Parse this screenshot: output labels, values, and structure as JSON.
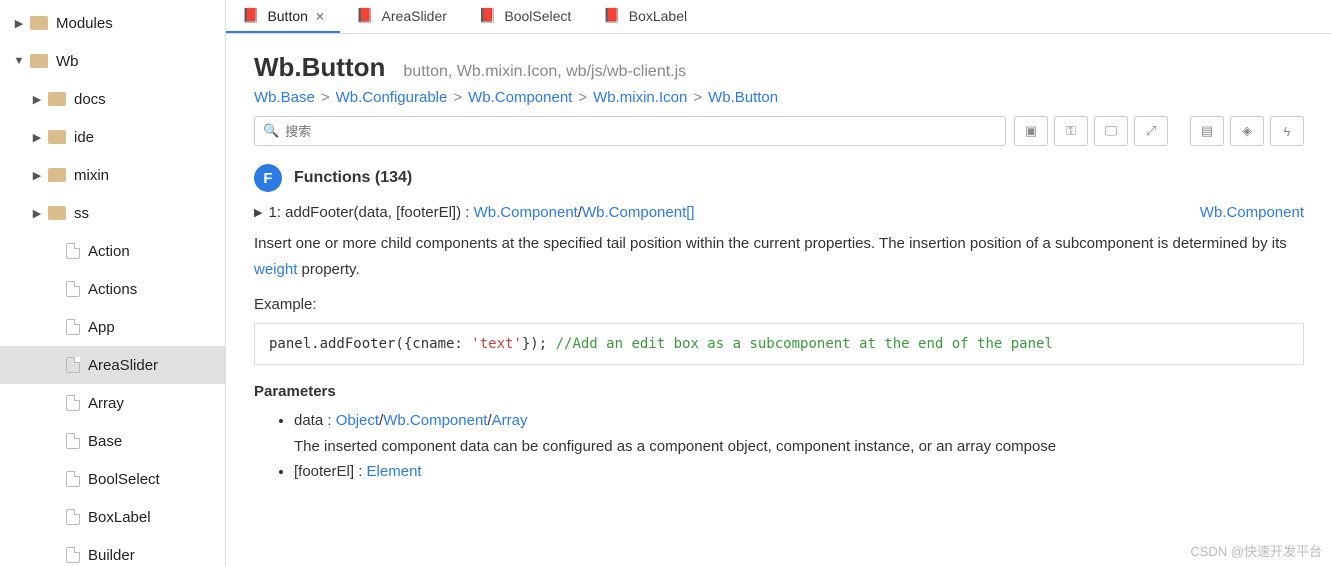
{
  "sidebar": {
    "items": [
      {
        "label": "Modules",
        "type": "folder",
        "arrow": "right",
        "depth": 0
      },
      {
        "label": "Wb",
        "type": "folder",
        "arrow": "down",
        "depth": 0
      },
      {
        "label": "docs",
        "type": "folder",
        "arrow": "right",
        "depth": 1
      },
      {
        "label": "ide",
        "type": "folder",
        "arrow": "right",
        "depth": 1
      },
      {
        "label": "mixin",
        "type": "folder",
        "arrow": "right",
        "depth": 1
      },
      {
        "label": "ss",
        "type": "folder",
        "arrow": "right",
        "depth": 1
      },
      {
        "label": "Action",
        "type": "file",
        "depth": 2
      },
      {
        "label": "Actions",
        "type": "file",
        "depth": 2
      },
      {
        "label": "App",
        "type": "file",
        "depth": 2
      },
      {
        "label": "AreaSlider",
        "type": "file",
        "depth": 2,
        "selected": true
      },
      {
        "label": "Array",
        "type": "file",
        "depth": 2
      },
      {
        "label": "Base",
        "type": "file",
        "depth": 2
      },
      {
        "label": "BoolSelect",
        "type": "file",
        "depth": 2
      },
      {
        "label": "BoxLabel",
        "type": "file",
        "depth": 2
      },
      {
        "label": "Builder",
        "type": "file",
        "depth": 2
      }
    ]
  },
  "tabs": [
    {
      "label": "Button",
      "active": true,
      "closable": true
    },
    {
      "label": "AreaSlider"
    },
    {
      "label": "BoolSelect"
    },
    {
      "label": "BoxLabel"
    }
  ],
  "page": {
    "title": "Wb.Button",
    "subtitle": "button, Wb.mixin.Icon, wb/js/wb-client.js",
    "breadcrumb": [
      "Wb.Base",
      "Wb.Configurable",
      "Wb.Component",
      "Wb.mixin.Icon",
      "Wb.Button"
    ],
    "search_placeholder": "搜索",
    "section": {
      "badge": "F",
      "title": "Functions (134)"
    },
    "func": {
      "index": "1",
      "name": "addFooter",
      "args": "(data, [footerEl])",
      "ret1": "Wb.Component",
      "ret2": "Wb.Component[]",
      "right_link": "Wb.Component"
    },
    "desc_pre": "Insert one or more child components at the specified tail position within the current properties. The insertion position of a subcomponent is determined by its ",
    "desc_link": "weight",
    "desc_post": " property.",
    "example_label": "Example:",
    "code": {
      "pre": "panel.addFooter({cname: ",
      "str": "'text'",
      "mid": "}); ",
      "cmt": "//Add an edit box as a subcomponent at the end of the panel"
    },
    "params_title": "Parameters",
    "params": [
      {
        "name": "data",
        "types": [
          "Object",
          "Wb.Component",
          "Array"
        ],
        "desc": "The inserted component data can be configured as a component object, component instance, or an array compose"
      },
      {
        "name": "[footerEl]",
        "types": [
          "Element"
        ]
      }
    ]
  },
  "watermark": "CSDN @快速开发平台"
}
